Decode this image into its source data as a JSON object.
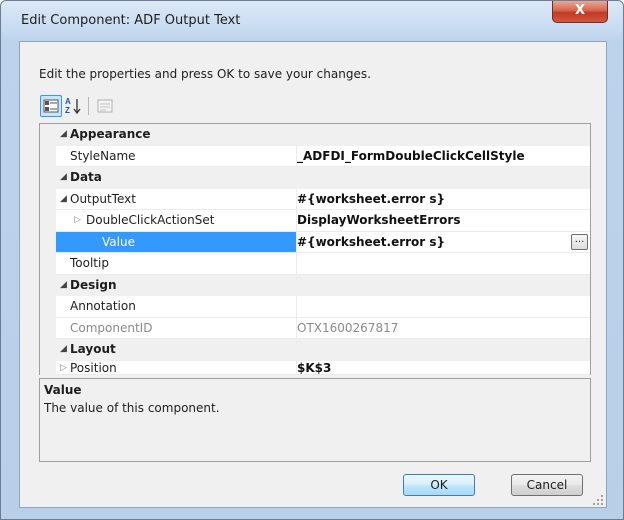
{
  "window": {
    "title": "Edit Component: ADF Output Text",
    "close_glyph": "X"
  },
  "instruction": "Edit the properties and press OK to save your changes.",
  "toolbar": {
    "categorized_icon": "categorized-view-icon",
    "alphabetical_icon": "alphabetical-sort-icon",
    "property_pages_icon": "property-pages-icon"
  },
  "categories": {
    "appearance": "Appearance",
    "data": "Data",
    "design": "Design",
    "layout": "Layout"
  },
  "properties": {
    "stylename": {
      "name": "StyleName",
      "value": "_ADFDI_FormDoubleClickCellStyle"
    },
    "outputtext": {
      "name": "OutputText",
      "value": "#{worksheet.error s}"
    },
    "doubleclick": {
      "name": "DoubleClickActionSet",
      "value": "DisplayWorksheetErrors"
    },
    "value": {
      "name": "Value",
      "value": "#{worksheet.error s}",
      "button": "..."
    },
    "tooltip": {
      "name": "Tooltip",
      "value": ""
    },
    "annotation": {
      "name": "Annotation",
      "value": ""
    },
    "componentid": {
      "name": "ComponentID",
      "value": "OTX1600267817"
    },
    "position": {
      "name": "Position",
      "value": "$K$3"
    }
  },
  "description": {
    "title": "Value",
    "text": "The value of this component."
  },
  "buttons": {
    "ok": "OK",
    "cancel": "Cancel"
  },
  "colors": {
    "selection": "#3399ff",
    "accent_border": "#3c7fb1",
    "close": "#c13a22"
  }
}
